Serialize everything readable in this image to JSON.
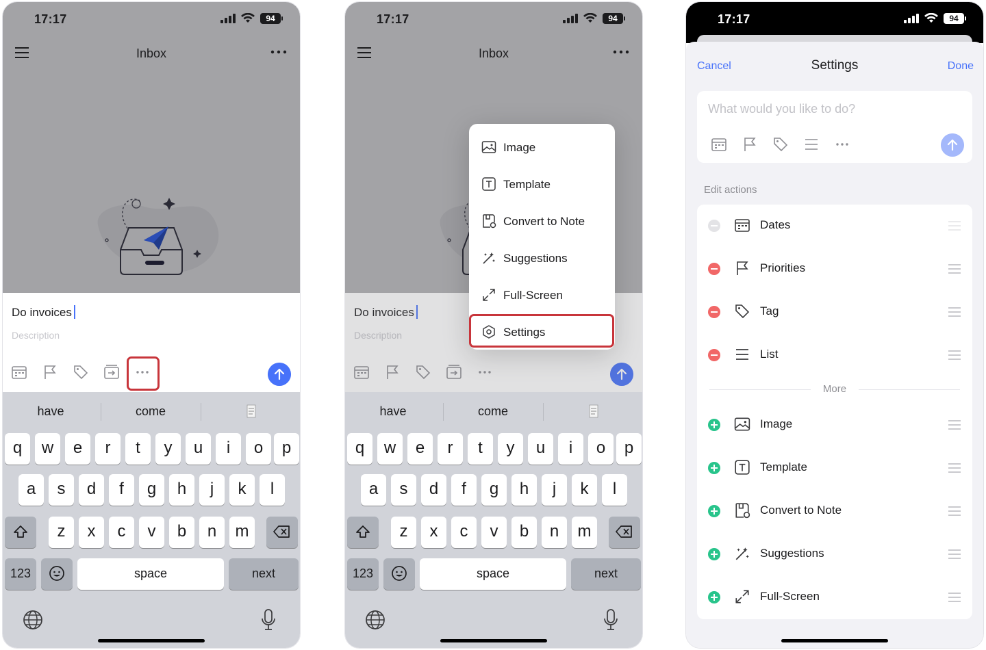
{
  "status": {
    "time": "17:17",
    "battery": "94"
  },
  "inbox": {
    "title": "Inbox",
    "task_title": "Do invoices",
    "description_placeholder": "Description"
  },
  "keyboard": {
    "suggestions": [
      "have",
      "come"
    ],
    "row1": [
      "q",
      "w",
      "e",
      "r",
      "t",
      "y",
      "u",
      "i",
      "o",
      "p"
    ],
    "row2": [
      "a",
      "s",
      "d",
      "f",
      "g",
      "h",
      "j",
      "k",
      "l"
    ],
    "row3": [
      "z",
      "x",
      "c",
      "v",
      "b",
      "n",
      "m"
    ],
    "num_label": "123",
    "space_label": "space",
    "next_label": "next"
  },
  "popup_menu": {
    "items": [
      "Image",
      "Template",
      "Convert to Note",
      "Suggestions",
      "Full-Screen",
      "Settings"
    ]
  },
  "settings": {
    "cancel": "Cancel",
    "title": "Settings",
    "done": "Done",
    "input_placeholder": "What would you like to do?",
    "edit_actions_label": "Edit actions",
    "more_label": "More",
    "active_actions": [
      "Dates",
      "Priorities",
      "Tag",
      "List"
    ],
    "more_actions": [
      "Image",
      "Template",
      "Convert to Note",
      "Suggestions",
      "Full-Screen"
    ]
  },
  "colors": {
    "accent": "#4772fa",
    "highlight": "#c8353b",
    "remove": "#f16767",
    "add": "#28c48b"
  }
}
